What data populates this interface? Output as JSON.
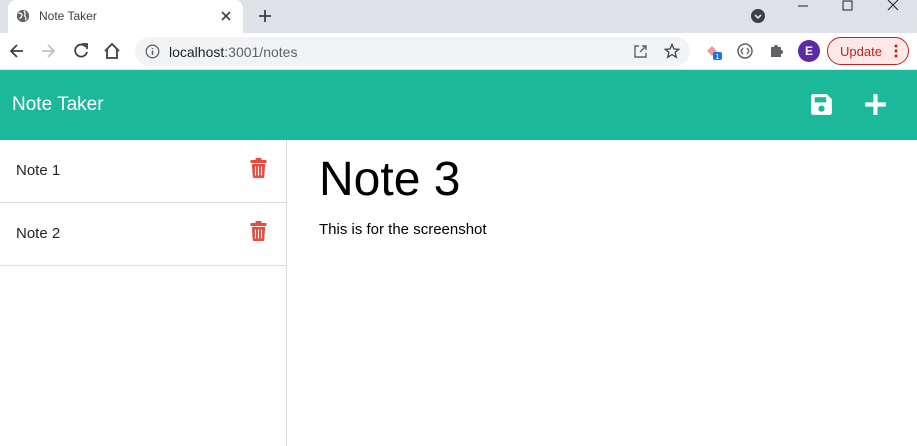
{
  "browser": {
    "tab": {
      "title": "Note Taker"
    },
    "address": {
      "host": "localhost",
      "path": ":3001/notes"
    },
    "profile_initial": "E",
    "update_label": "Update",
    "extension_badge": "1"
  },
  "app": {
    "title": "Note Taker",
    "notes": [
      {
        "title": "Note 1"
      },
      {
        "title": "Note 2"
      }
    ],
    "active_note": {
      "title": "Note 3",
      "text": "This is for the screenshot"
    }
  },
  "colors": {
    "header": "#1bb899",
    "trash": "#e74c3c",
    "update": "#c5221f"
  },
  "icons": [
    "globe-icon",
    "close-icon",
    "plus-icon",
    "back-icon",
    "forward-icon",
    "reload-icon",
    "home-icon",
    "info-icon",
    "share-icon",
    "star-icon",
    "extension-icon",
    "puzzle-icon",
    "save-icon",
    "trash-icon"
  ]
}
